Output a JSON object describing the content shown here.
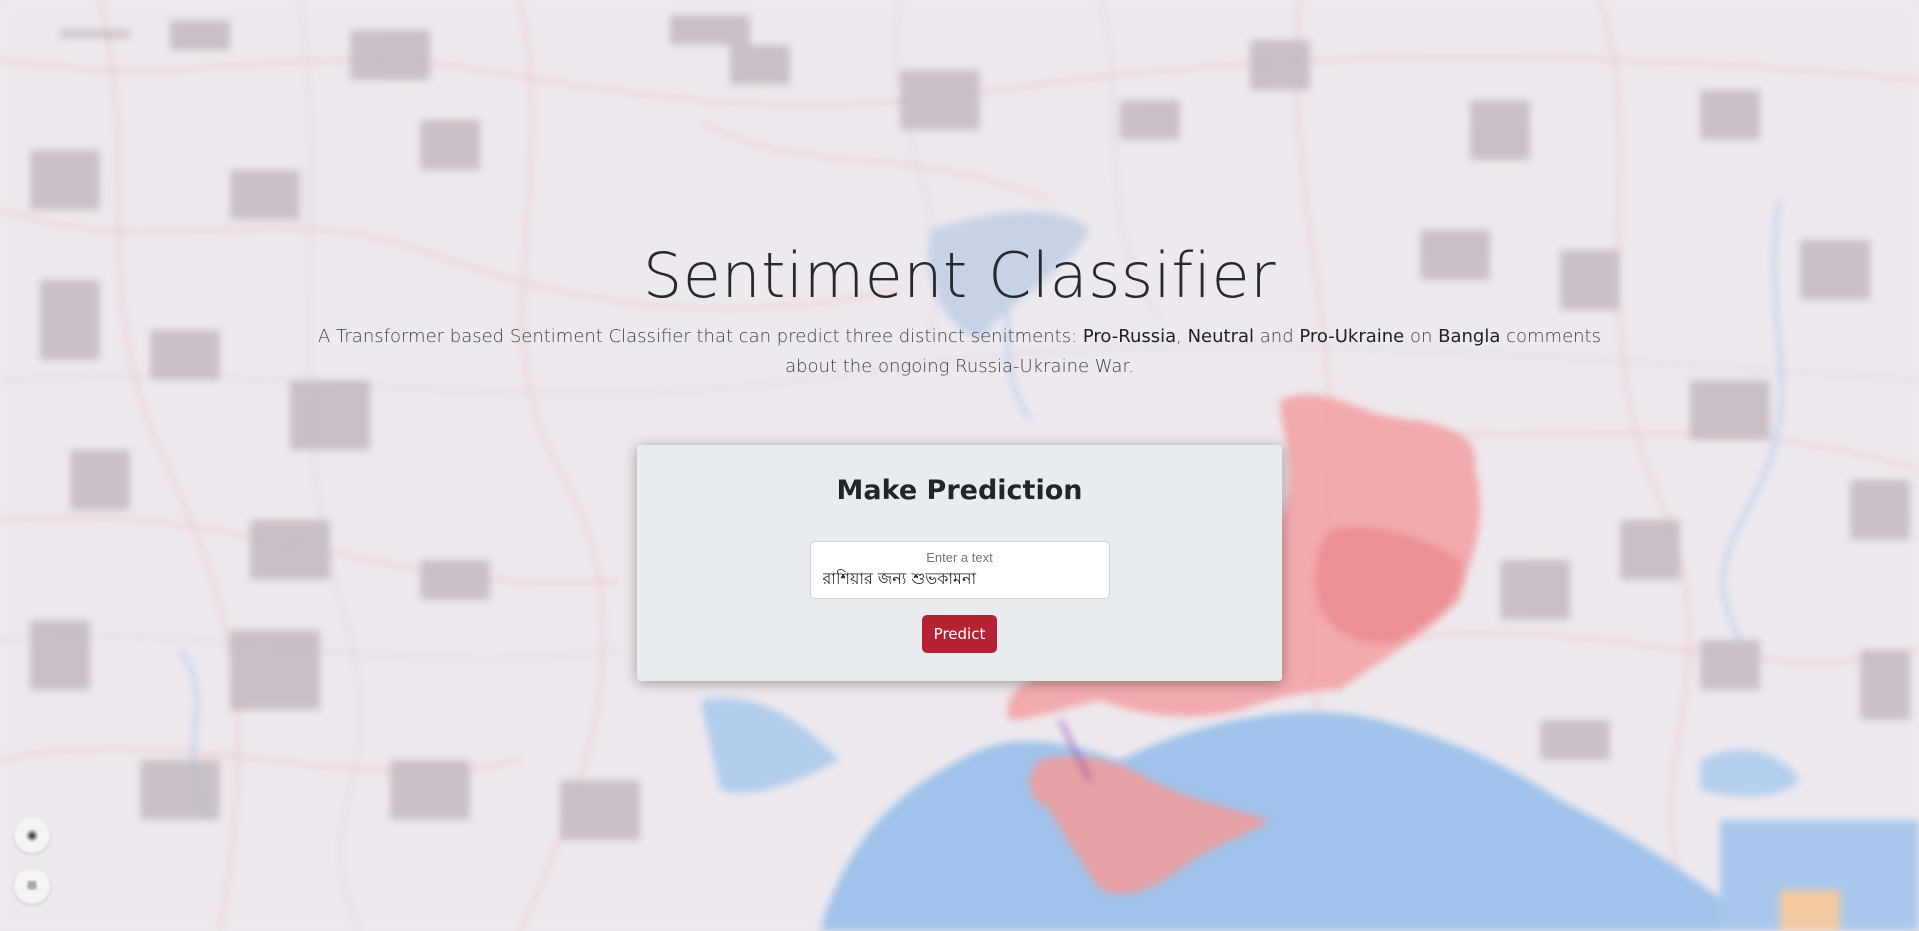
{
  "hero": {
    "title": "Sentiment Classifier",
    "desc_part1": "A Transformer based Sentiment Classifier that can predict three distinct senitments: ",
    "label_pro_russia": "Pro-Russia",
    "sep1": ", ",
    "label_neutral": "Neutral",
    "sep2": " and ",
    "label_pro_ukraine": "Pro-Ukraine",
    "sep3": " on ",
    "label_bangla": "Bangla",
    "desc_part2": " comments about the ongoing Russia-Ukraine War."
  },
  "card": {
    "title": "Make Prediction",
    "input_label": "Enter a text",
    "input_value": "রাশিয়ার জন্য শুভকামনা",
    "button_label": "Predict"
  },
  "colors": {
    "accent": "#b42135",
    "card_bg": "#e9ecef",
    "map_bg": "#eee9ee",
    "water": "#9fc3ea",
    "occupied_region": "#f2a3a5"
  },
  "icons": {
    "locate": "crosshair-icon",
    "layers": "layers-icon"
  }
}
